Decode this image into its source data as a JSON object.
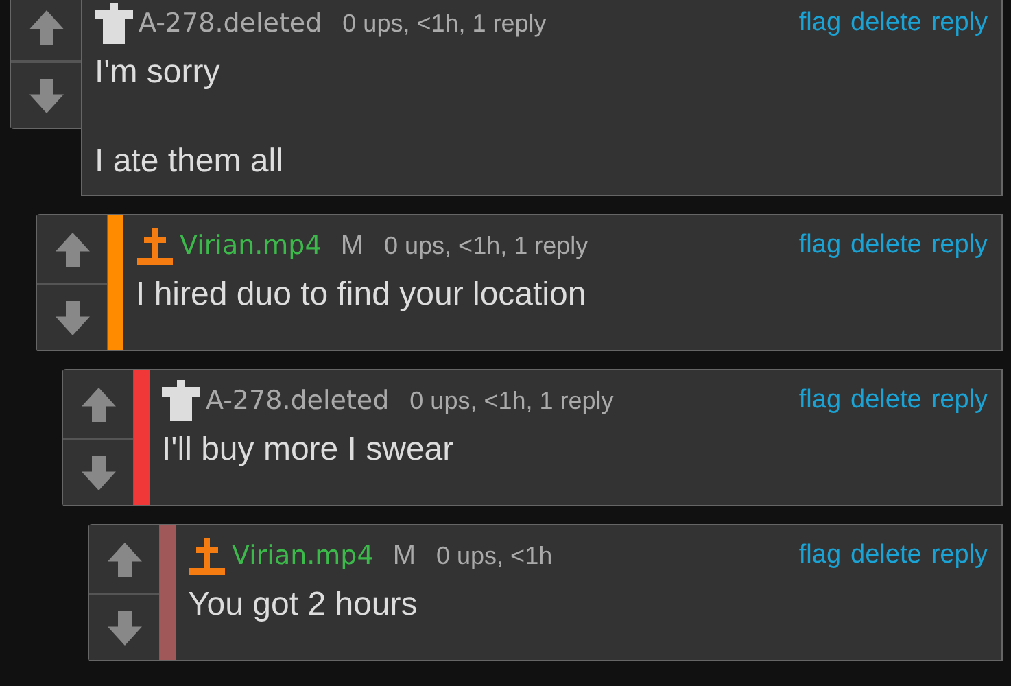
{
  "comments": [
    {
      "kind": "deleted",
      "username": "A-278.deleted",
      "meta": "0 ups, <1h, 1 reply",
      "actions": [
        "flag",
        "delete",
        "reply"
      ],
      "body": "I'm sorry\n\nI ate them all",
      "children": [
        {
          "kind": "user",
          "color": "#ff8c00",
          "username": "Virian.mp4",
          "badge": "M",
          "meta": "0 ups, <1h, 1 reply",
          "actions": [
            "flag",
            "delete",
            "reply"
          ],
          "body": "I hired duo to find your location",
          "children": [
            {
              "kind": "deleted",
              "color": "#f03838",
              "username": "A-278.deleted",
              "meta": "0 ups, <1h, 1 reply",
              "actions": [
                "flag",
                "delete",
                "reply"
              ],
              "body": "I'll buy more I swear",
              "children": [
                {
                  "kind": "user",
                  "color": "#a05858",
                  "username": "Virian.mp4",
                  "badge": "M",
                  "meta": "0 ups, <1h",
                  "actions": [
                    "flag",
                    "delete",
                    "reply"
                  ],
                  "body": "You got 2 hours"
                }
              ]
            }
          ]
        }
      ]
    }
  ]
}
